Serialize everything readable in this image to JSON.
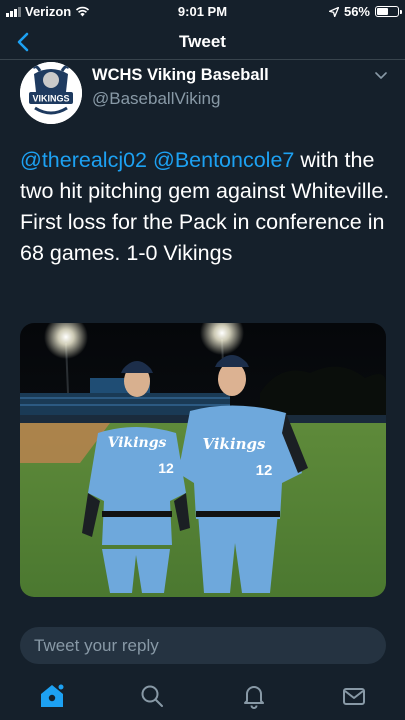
{
  "status_bar": {
    "carrier": "Verizon",
    "time": "9:01 PM",
    "battery": "56%",
    "battery_level": 0.56
  },
  "header": {
    "title": "Tweet"
  },
  "tweet": {
    "author_name": "WCHS Viking Baseball",
    "author_handle": "@BaseballViking",
    "mention_1": "@therealcj02",
    "mention_2": "@Bentoncole7",
    "text": " with the two hit pitching gem against Whiteville.  First loss for the Pack in conference in 68 games.  1-0 Vikings",
    "jersey_text": "Vikings",
    "jersey_number": "12",
    "avatar_text": "VIKINGS"
  },
  "reply": {
    "placeholder": "Tweet your reply"
  },
  "tabs": [
    {
      "icon": "home-icon",
      "active": true
    },
    {
      "icon": "search-icon",
      "active": false
    },
    {
      "icon": "notifications-icon",
      "active": false
    },
    {
      "icon": "messages-icon",
      "active": false
    }
  ],
  "colors": {
    "background": "#15202b",
    "accent": "#1da1f2",
    "muted": "#8899a6",
    "jersey": "#6ea8dc"
  }
}
